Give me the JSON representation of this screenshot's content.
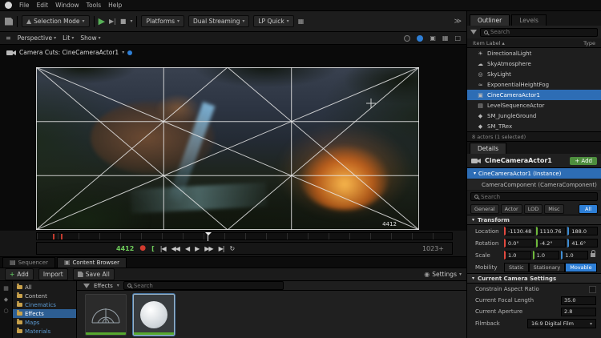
{
  "menubar": {
    "items": [
      "File",
      "Edit",
      "Window",
      "Tools",
      "Help"
    ]
  },
  "toolbar": {
    "selection_mode": "Selection Mode",
    "platforms": "Platforms",
    "dual_streaming": "Dual Streaming",
    "lp_quick": "LP Quick"
  },
  "viewport_toolbar": {
    "perspective": "Perspective",
    "lit": "Lit",
    "show": "Show"
  },
  "camera_cuts": {
    "label": "Camera Cuts: CineCameraActor1"
  },
  "viewport": {
    "frame": "4412"
  },
  "transport": {
    "timecode": "4412",
    "end": "1023+",
    "icons": [
      {
        "name": "to-front",
        "glyph": "|◀"
      },
      {
        "name": "prev-frame",
        "glyph": "◀◀"
      },
      {
        "name": "play-reverse",
        "glyph": "◀"
      },
      {
        "name": "play",
        "glyph": "▶"
      },
      {
        "name": "next-frame",
        "glyph": "▶▶"
      },
      {
        "name": "to-end",
        "glyph": "▶|"
      },
      {
        "name": "loop",
        "glyph": "↻"
      }
    ]
  },
  "outliner": {
    "tabs": [
      "Outliner",
      "Levels"
    ],
    "search_placeholder": "Search",
    "columns": {
      "label": "Item Label",
      "type": "Type"
    },
    "items": [
      {
        "glyph": "☀",
        "label": "DirectionalLight"
      },
      {
        "glyph": "☁",
        "label": "SkyAtmosphere"
      },
      {
        "glyph": "◎",
        "label": "SkyLight"
      },
      {
        "glyph": "≈",
        "label": "ExponentialHeightFog"
      },
      {
        "glyph": "▣",
        "label": "CineCameraActor1"
      },
      {
        "glyph": "▤",
        "label": "LevelSequenceActor"
      },
      {
        "glyph": "◆",
        "label": "SM_JungleGround"
      },
      {
        "glyph": "◆",
        "label": "SM_TRex"
      }
    ],
    "footer": "8 actors (1 selected)"
  },
  "details": {
    "tab": "Details",
    "name": "CineCameraActor1",
    "add_button": "+ Add",
    "components": [
      {
        "label": "CineCameraActor1 (Instance)"
      },
      {
        "label": "CameraComponent (CameraComponent)"
      }
    ],
    "search_placeholder": "Search",
    "filters": [
      "General",
      "Actor",
      "LOD",
      "Misc"
    ],
    "filter_all": "All",
    "transform": {
      "header": "Transform",
      "location": {
        "label": "Location",
        "x": "-1130.48",
        "y": "1110.76",
        "z": "188.0"
      },
      "rotation": {
        "label": "Rotation",
        "x": "0.0°",
        "y": "-4.2°",
        "z": "41.6°"
      },
      "scale": {
        "label": "Scale",
        "x": "1.0",
        "y": "1.0",
        "z": "1.0"
      },
      "mobility": {
        "label": "Mobility",
        "options": [
          "Static",
          "Stationary",
          "Movable"
        ],
        "selected": "Movable"
      }
    },
    "camera_settings": {
      "header": "Current Camera Settings",
      "rows": [
        {
          "label": "Constrain Aspect Ratio",
          "type": "checkbox"
        },
        {
          "label": "Current Focal Length",
          "value": "35.0"
        },
        {
          "label": "Current Aperture",
          "value": "2.8"
        },
        {
          "label": "Filmback",
          "value": "16:9 Digital Film"
        }
      ]
    }
  },
  "bottom": {
    "tabs": [
      {
        "label": "Sequencer"
      },
      {
        "label": "Content Browser"
      }
    ],
    "toolbar": {
      "add": "Add",
      "import": "Import",
      "save_all": "Save All",
      "search_placeholder": "Search",
      "settings": "Settings"
    },
    "folders": [
      "All",
      "Content",
      "Cinematics",
      "Effects",
      "Maps",
      "Materials"
    ],
    "selected_folder": "Effects",
    "breadcrumb": "Effects"
  },
  "colors": {
    "accent": "#2e7fd6",
    "green": "#58b158",
    "record": "#d23b2f",
    "axis_x": "#e2493f",
    "axis_y": "#6fba3c",
    "axis_z": "#3f8fd6"
  }
}
